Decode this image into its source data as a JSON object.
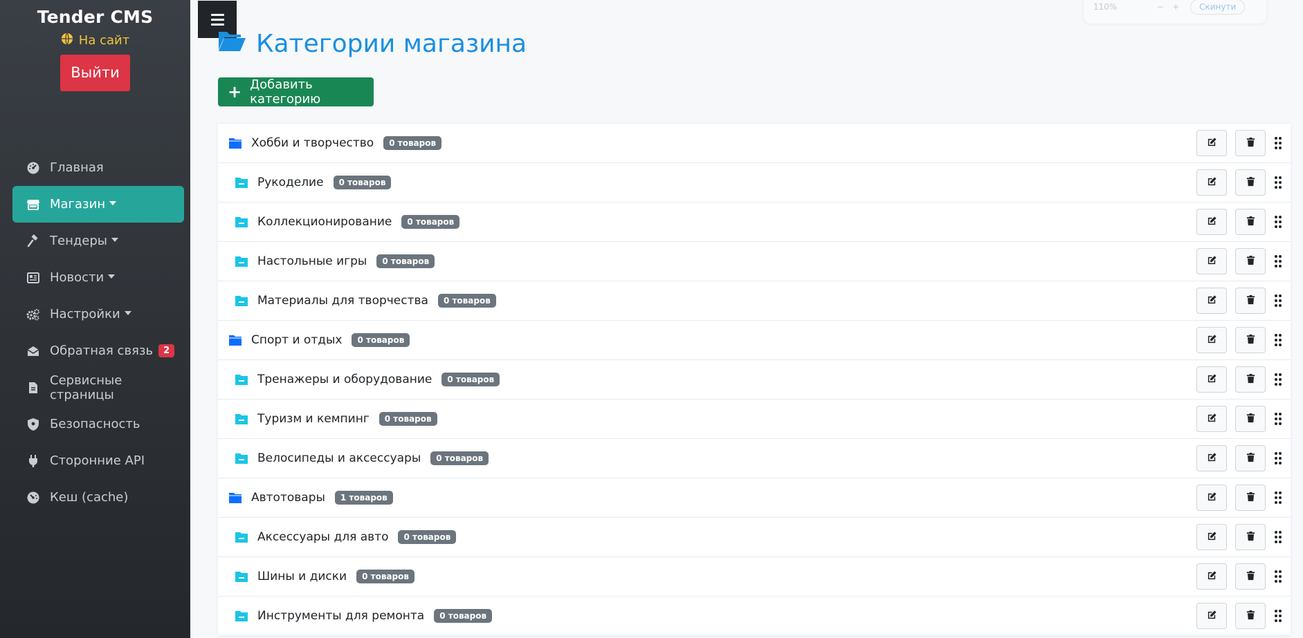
{
  "sidebar": {
    "brand": "Tender CMS",
    "site_link": "На сайт",
    "logout": "Выйти",
    "items": [
      {
        "label": "Главная",
        "icon": "dashboard-icon"
      },
      {
        "label": "Магазин",
        "icon": "store-icon",
        "active": true,
        "dropdown": true
      },
      {
        "label": "Тендеры",
        "icon": "gavel-icon",
        "dropdown": true
      },
      {
        "label": "Новости",
        "icon": "newspaper-icon",
        "dropdown": true
      },
      {
        "label": "Настройки",
        "icon": "gears-icon",
        "dropdown": true
      },
      {
        "label": "Обратная связь",
        "icon": "envelope-open-icon",
        "badge": "2"
      },
      {
        "label": "Сервисные страницы",
        "icon": "file-icon"
      },
      {
        "label": "Безопасность",
        "icon": "shield-icon"
      },
      {
        "label": "Сторонние API",
        "icon": "plug-icon"
      },
      {
        "label": "Кеш (cache)",
        "icon": "gauge-icon"
      }
    ]
  },
  "zoom": {
    "level": "110%",
    "minus": "−",
    "plus": "+",
    "reset": "Скинути"
  },
  "page": {
    "title": "Категории магазина",
    "add_button": "Добавить категорию"
  },
  "categories": [
    {
      "name": "Хобби и творчество",
      "count": "0 товаров",
      "level": "parent"
    },
    {
      "name": "Рукоделие",
      "count": "0 товаров",
      "level": "child"
    },
    {
      "name": "Коллекционирование",
      "count": "0 товаров",
      "level": "child"
    },
    {
      "name": "Настольные игры",
      "count": "0 товаров",
      "level": "child"
    },
    {
      "name": "Материалы для творчества",
      "count": "0 товаров",
      "level": "child"
    },
    {
      "name": "Спорт и отдых",
      "count": "0 товаров",
      "level": "parent"
    },
    {
      "name": "Тренажеры и оборудование",
      "count": "0 товаров",
      "level": "child"
    },
    {
      "name": "Туризм и кемпинг",
      "count": "0 товаров",
      "level": "child"
    },
    {
      "name": "Велосипеды и аксессуары",
      "count": "0 товаров",
      "level": "child"
    },
    {
      "name": "Автотовары",
      "count": "1 товаров",
      "level": "parent"
    },
    {
      "name": "Аксессуары для авто",
      "count": "0 товаров",
      "level": "child"
    },
    {
      "name": "Шины и диски",
      "count": "0 товаров",
      "level": "child"
    },
    {
      "name": "Инструменты для ремонта",
      "count": "0 товаров",
      "level": "child"
    }
  ],
  "colors": {
    "sidebar_active": "#26a69a",
    "logout": "#dc3545",
    "title": "#1a8fe0",
    "add_button": "#198754",
    "parent_folder": "#0d6efd",
    "child_folder": "#1bc5e6",
    "count_badge": "#6c757d"
  }
}
